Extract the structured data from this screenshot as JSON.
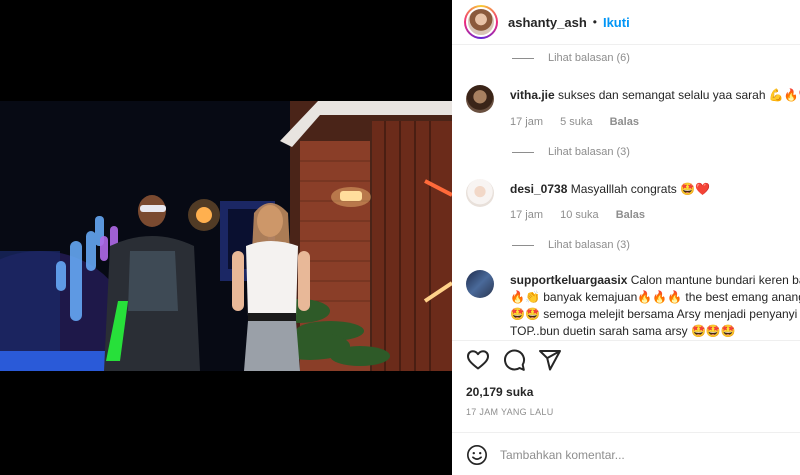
{
  "post": {
    "username": "ashanty_ash",
    "separator": "•",
    "follow_label": "Ikuti"
  },
  "threads": [
    {
      "replies_label": "Lihat balasan (6)"
    },
    {
      "comment": {
        "username": "vitha.jie",
        "text": "sukses dan semangat selalu yaa sarah 💪🔥❤️",
        "time": "17 jam",
        "likes": "5 suka",
        "reply_label": "Balas"
      },
      "replies_label": "Lihat balasan (3)"
    },
    {
      "comment": {
        "username": "desi_0738",
        "text": "Masyalllah congrats 🤩❤️",
        "time": "17 jam",
        "likes": "10 suka",
        "reply_label": "Balas"
      },
      "replies_label": "Lihat balasan (3)"
    },
    {
      "comment": {
        "username": "supportkeluargaasix",
        "lines": [
          "Calon mantune bundari keren banget",
          "🔥👏 banyak kemajuan🔥🔥🔥 the best emang anang",
          "🤩🤩 semoga melejit bersama Arsy menjadi penyanyi",
          "TOP..bun duetin sarah sama arsy 🤩🤩🤩"
        ]
      }
    }
  ],
  "footer": {
    "likes": "20,179 suka",
    "posted": "17 JAM YANG LALU",
    "comment_placeholder": "Tambahkan komentar..."
  },
  "icons": {
    "like": "heart-icon",
    "comment": "comment-icon",
    "share": "share-icon",
    "emoji": "emoji-icon"
  }
}
